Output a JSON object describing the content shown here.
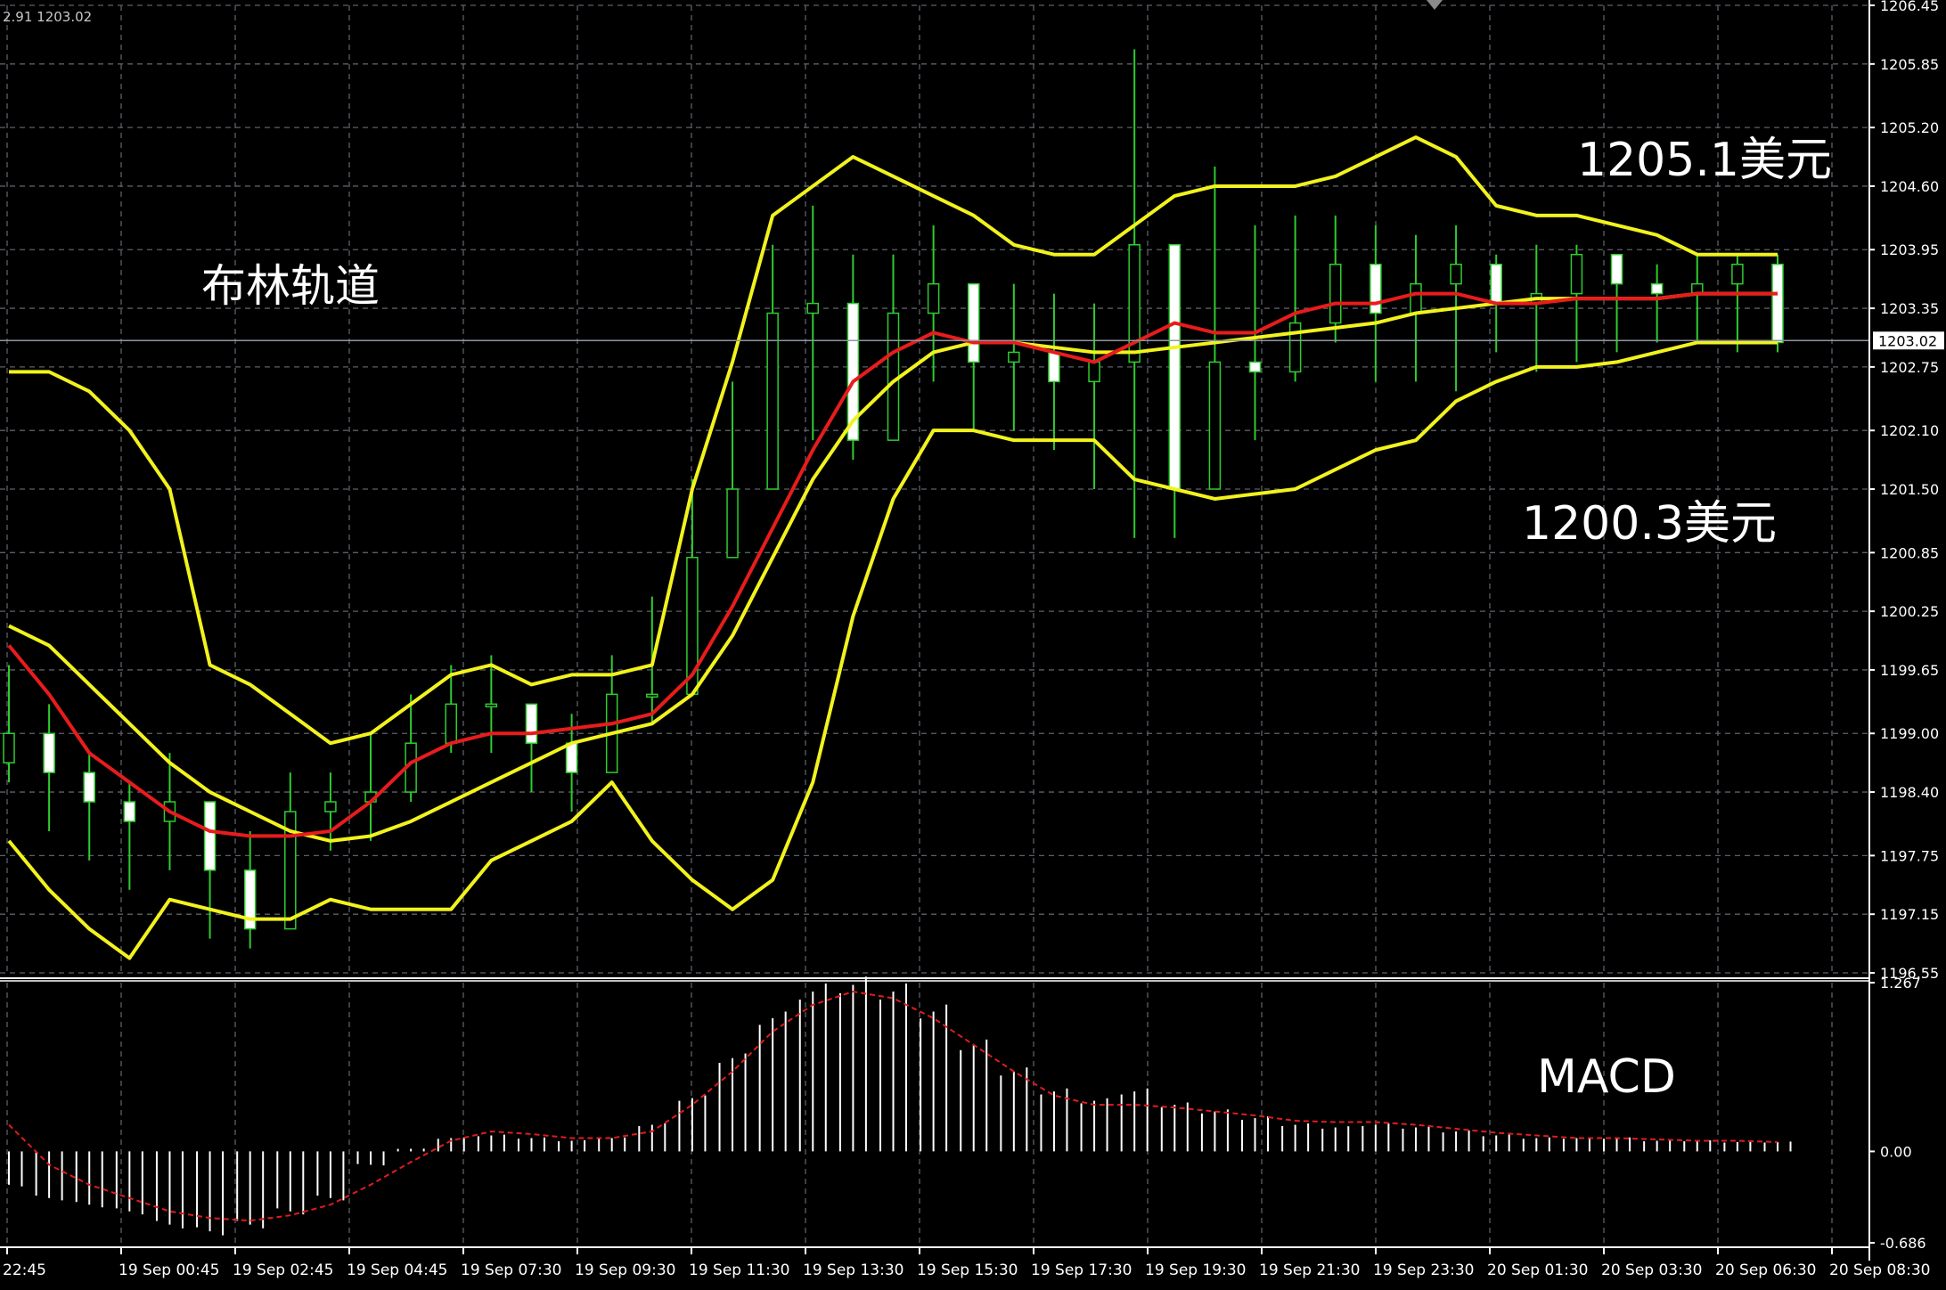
{
  "chart_data": {
    "type": "candlestick",
    "header_text": "2.91 1203.02",
    "current_price": 1203.02,
    "price_axis": {
      "ylim": [
        1196.55,
        1206.45
      ],
      "ticks": [
        "1206.45",
        "1205.85",
        "1205.20",
        "1204.60",
        "1203.95",
        "1203.35",
        "1202.75",
        "1202.10",
        "1201.50",
        "1200.85",
        "1200.25",
        "1199.65",
        "1199.00",
        "1198.40",
        "1197.75",
        "1197.15",
        "1196.55"
      ],
      "current_label": "1203.02"
    },
    "macd_axis": {
      "ylim": [
        -0.686,
        1.267
      ],
      "ticks": [
        "1.267",
        "0.00",
        "-0.686"
      ]
    },
    "time_labels": [
      "22:45",
      "19 Sep 00:45",
      "19 Sep 02:45",
      "19 Sep 04:45",
      "19 Sep 07:30",
      "19 Sep 09:30",
      "19 Sep 11:30",
      "19 Sep 13:30",
      "19 Sep 15:30",
      "19 Sep 17:30",
      "19 Sep 19:30",
      "19 Sep 21:30",
      "19 Sep 23:30",
      "20 Sep 01:30",
      "20 Sep 03:30",
      "20 Sep 06:30",
      "20 Sep 08:30"
    ],
    "annotations": {
      "bollinger": "布林轨道",
      "upper_price": "1205.1美元",
      "lower_price": "1200.3美元",
      "macd": "MACD"
    },
    "series": [
      {
        "name": "Upper",
        "values": [
          1202.7,
          1202.7,
          1202.5,
          1202.1,
          1201.5,
          1199.7,
          1199.5,
          1199.2,
          1198.9,
          1199.0,
          1199.3,
          1199.6,
          1199.7,
          1199.5,
          1199.6,
          1199.6,
          1199.7,
          1201.5,
          1202.8,
          1204.3,
          1204.6,
          1204.9,
          1204.7,
          1204.5,
          1204.3,
          1204.0,
          1203.9,
          1203.9,
          1204.2,
          1204.5,
          1204.6,
          1204.6,
          1204.6,
          1204.7,
          1204.9,
          1205.1,
          1204.9,
          1204.4,
          1204.3,
          1204.3,
          1204.2,
          1204.1,
          1203.9,
          1203.9,
          1203.9
        ]
      },
      {
        "name": "Middle",
        "values": [
          1200.1,
          1199.9,
          1199.5,
          1199.1,
          1198.7,
          1198.4,
          1198.2,
          1198.0,
          1197.9,
          1197.95,
          1198.1,
          1198.3,
          1198.5,
          1198.7,
          1198.9,
          1199.0,
          1199.1,
          1199.4,
          1200.0,
          1200.8,
          1201.6,
          1202.2,
          1202.6,
          1202.9,
          1203.0,
          1203.0,
          1202.95,
          1202.9,
          1202.9,
          1202.95,
          1203.0,
          1203.05,
          1203.1,
          1203.15,
          1203.2,
          1203.3,
          1203.35,
          1203.4,
          1203.45,
          1203.45,
          1203.45,
          1203.45,
          1203.5,
          1203.5,
          1203.5
        ]
      },
      {
        "name": "Lower",
        "values": [
          1197.9,
          1197.4,
          1197.0,
          1196.7,
          1197.3,
          1197.2,
          1197.1,
          1197.1,
          1197.3,
          1197.2,
          1197.2,
          1197.2,
          1197.7,
          1197.9,
          1198.1,
          1198.5,
          1197.9,
          1197.5,
          1197.2,
          1197.5,
          1198.5,
          1200.2,
          1201.4,
          1202.1,
          1202.1,
          1202.0,
          1202.0,
          1202.0,
          1201.6,
          1201.5,
          1201.4,
          1201.45,
          1201.5,
          1201.7,
          1201.9,
          1202.0,
          1202.4,
          1202.6,
          1202.75,
          1202.75,
          1202.8,
          1202.9,
          1203.0,
          1203.0,
          1203.0
        ]
      },
      {
        "name": "MA",
        "values": [
          1199.9,
          1199.4,
          1198.8,
          1198.5,
          1198.2,
          1198.0,
          1197.95,
          1197.95,
          1198.0,
          1198.3,
          1198.7,
          1198.9,
          1199.0,
          1199.0,
          1199.05,
          1199.1,
          1199.2,
          1199.6,
          1200.3,
          1201.1,
          1201.9,
          1202.6,
          1202.9,
          1203.1,
          1203.0,
          1203.0,
          1202.9,
          1202.8,
          1203.0,
          1203.2,
          1203.1,
          1203.1,
          1203.3,
          1203.4,
          1203.4,
          1203.5,
          1203.5,
          1203.4,
          1203.4,
          1203.45,
          1203.45,
          1203.45,
          1203.5,
          1203.5,
          1203.5
        ]
      },
      {
        "name": "MACD histogram",
        "values": [
          -0.25,
          -0.35,
          -0.4,
          -0.45,
          -0.55,
          -0.6,
          -0.55,
          -0.45,
          -0.35,
          -0.1,
          0.02,
          0.1,
          0.12,
          0.1,
          0.08,
          0.1,
          0.2,
          0.4,
          0.7,
          1.0,
          1.2,
          1.25,
          1.2,
          1.05,
          0.8,
          0.6,
          0.45,
          0.38,
          0.45,
          0.35,
          0.3,
          0.25,
          0.2,
          0.18,
          0.2,
          0.18,
          0.15,
          0.12,
          0.1,
          0.1,
          0.1,
          0.08,
          0.08,
          0.07,
          0.07
        ]
      },
      {
        "name": "MACD signal",
        "values": [
          0.2,
          -0.1,
          -0.25,
          -0.35,
          -0.45,
          -0.5,
          -0.52,
          -0.48,
          -0.4,
          -0.25,
          -0.08,
          0.08,
          0.15,
          0.13,
          0.1,
          0.1,
          0.15,
          0.35,
          0.6,
          0.9,
          1.1,
          1.2,
          1.15,
          1.0,
          0.8,
          0.6,
          0.42,
          0.35,
          0.35,
          0.33,
          0.3,
          0.27,
          0.23,
          0.22,
          0.22,
          0.2,
          0.17,
          0.14,
          0.12,
          0.1,
          0.1,
          0.09,
          0.08,
          0.08,
          0.07
        ]
      },
      {
        "name": "Close",
        "values": [
          1199.0,
          1198.6,
          1198.3,
          1198.1,
          1198.3,
          1197.6,
          1197.0,
          1198.2,
          1198.3,
          1198.4,
          1198.9,
          1199.3,
          1199.3,
          1198.9,
          1198.6,
          1199.4,
          1199.4,
          1200.8,
          1201.5,
          1203.3,
          1203.4,
          1202.0,
          1203.3,
          1203.6,
          1202.8,
          1202.9,
          1202.6,
          1202.8,
          1204.0,
          1201.5,
          1202.8,
          1202.7,
          1203.2,
          1203.8,
          1203.3,
          1203.6,
          1203.8,
          1203.4,
          1203.5,
          1203.9,
          1203.6,
          1203.5,
          1203.6,
          1203.8,
          1203.0
        ]
      },
      {
        "name": "High",
        "values": [
          1199.7,
          1199.3,
          1198.8,
          1198.5,
          1198.8,
          1198.2,
          1198.0,
          1198.6,
          1198.6,
          1199.0,
          1199.4,
          1199.7,
          1199.8,
          1199.3,
          1199.2,
          1199.8,
          1200.4,
          1201.6,
          1202.6,
          1204.0,
          1204.4,
          1203.9,
          1203.9,
          1204.2,
          1203.3,
          1203.6,
          1203.5,
          1203.4,
          1206.0,
          1203.9,
          1204.8,
          1204.2,
          1204.3,
          1204.3,
          1204.2,
          1204.1,
          1204.2,
          1203.9,
          1204.0,
          1204.0,
          1203.9,
          1203.8,
          1203.9,
          1203.9,
          1203.9
        ]
      },
      {
        "name": "Low",
        "values": [
          1198.5,
          1198.0,
          1197.7,
          1197.4,
          1197.6,
          1196.9,
          1196.8,
          1197.2,
          1197.8,
          1197.9,
          1198.3,
          1198.8,
          1198.8,
          1198.4,
          1198.2,
          1198.6,
          1199.1,
          1199.8,
          1200.9,
          1202.4,
          1202.0,
          1201.8,
          1202.6,
          1202.6,
          1202.1,
          1202.1,
          1201.9,
          1201.5,
          1201.0,
          1201.0,
          1201.7,
          1202.0,
          1202.6,
          1203.0,
          1202.6,
          1202.6,
          1202.5,
          1202.9,
          1202.7,
          1202.8,
          1202.9,
          1203.0,
          1203.0,
          1202.9,
          1202.9
        ]
      }
    ]
  }
}
